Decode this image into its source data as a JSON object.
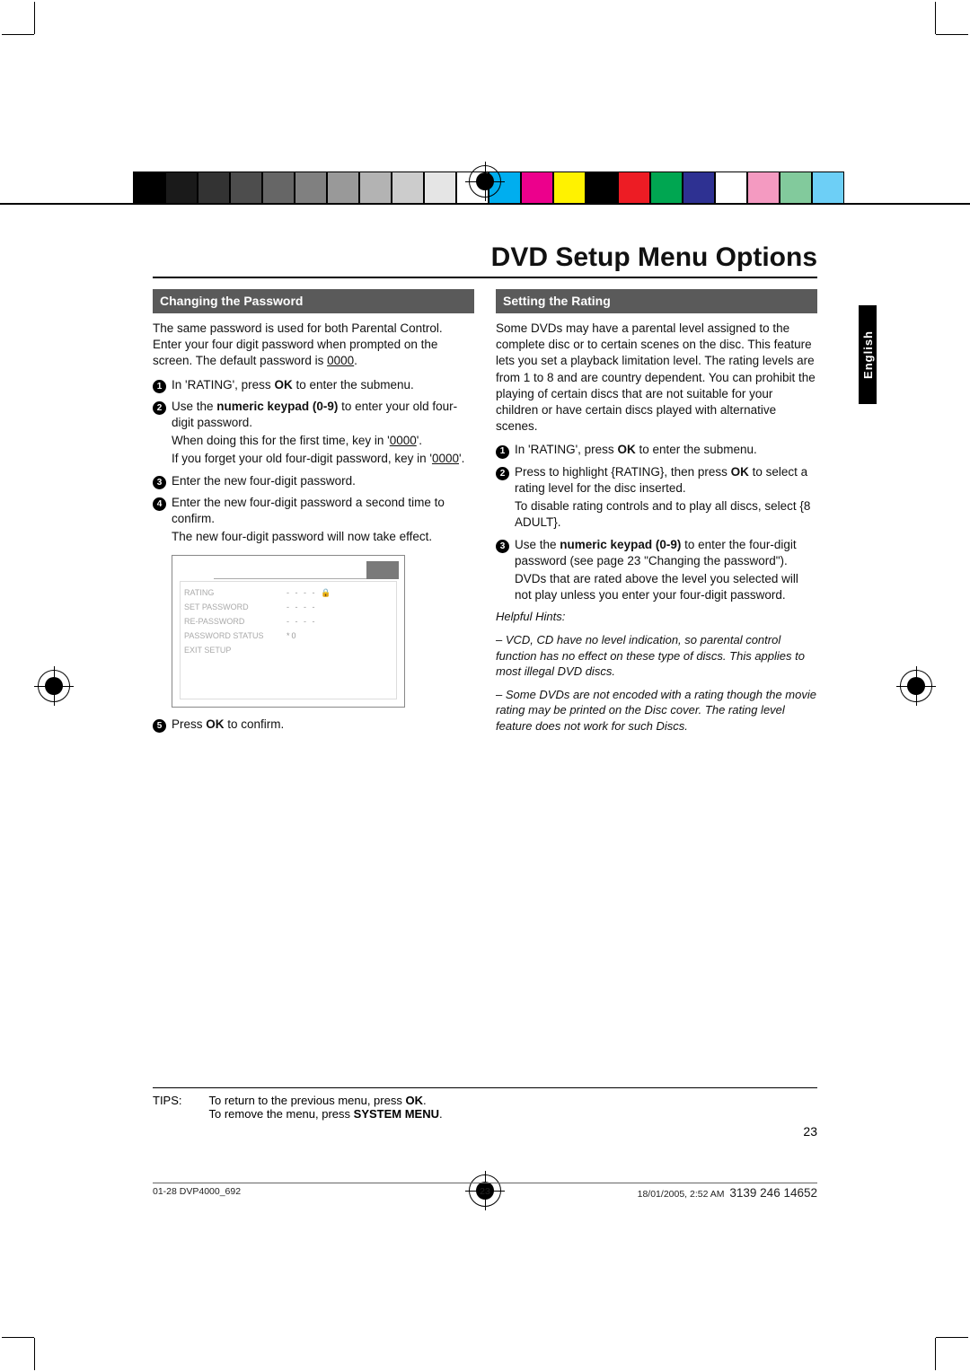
{
  "page_title": "DVD Setup Menu Options",
  "lang_tab": "English",
  "left": {
    "heading": "Changing the Password",
    "intro_a": "The same password is used for both Parental Control. Enter your four digit password when prompted on the screen. The default password is ",
    "intro_default": "0000",
    "intro_b": ".",
    "steps": {
      "s1_a": "In 'RATING', press ",
      "s1_b": " to enter the submenu.",
      "s2_a": "Use the ",
      "s2_kbd": "numeric keypad (0-9)",
      "s2_b": " to enter your old four-digit password.",
      "s2_sub1_a": "When doing this for the first time, key in '",
      "s2_sub_pwd": "0000",
      "s2_sub1_b": "'.",
      "s2_sub2_a": "If you forget your old four-digit password, key in '",
      "s2_sub2_b": "'.",
      "s3": "Enter the new four-digit password.",
      "s4": "Enter the new four-digit password a second time to confirm.",
      "s4_sub": "The new four-digit password will now take effect.",
      "s5_a": "Press ",
      "s5_b": " to confirm."
    },
    "ok_label": "OK"
  },
  "osd": {
    "menu": [
      "RATING",
      "SET PASSWORD",
      "RE-PASSWORD",
      "PASSWORD STATUS",
      "EXIT SETUP"
    ],
    "fields": [
      "- - - -  🔒",
      "- - - -",
      "- - - -",
      "*0"
    ]
  },
  "right": {
    "heading": "Setting the Rating",
    "intro": "Some DVDs may have a parental level assigned to the complete disc or to certain scenes on the disc. This feature lets you set a playback limitation level. The rating levels are from 1 to 8 and are country dependent. You can prohibit the playing of certain discs that are not suitable for your children or have certain discs played with alternative scenes.",
    "steps": {
      "s1_a": "In 'RATING', press ",
      "s1_b": " to enter the submenu.",
      "s2_a": "Press ",
      "s2_mid": " to highlight {RATING}, then press ",
      "s2_b": " to select a rating level for the disc inserted.",
      "s2_sub": "To disable rating controls and to play all discs, select {8 ADULT}.",
      "s3_a": "Use the ",
      "s3_kbd": "numeric keypad (0-9)",
      "s3_b": " to enter the four-digit password (see page 23 \"Changing the password\").",
      "s3_sub": "DVDs that are rated above the level you selected will not play unless you enter your four-digit password."
    },
    "ok_label": "OK",
    "hints_title": "Helpful Hints:",
    "hint1": "–   VCD, CD have no level indication, so parental control function has no effect on these type of discs. This applies to most illegal DVD discs.",
    "hint2": "–   Some DVDs are not encoded with a rating though the movie rating may be printed on the Disc cover. The rating level feature does not work for such Discs."
  },
  "tips": {
    "label": "TIPS:",
    "line1_a": "To return to the previous menu, press ",
    "line1_b": ".",
    "line2_a": "To remove the menu, press ",
    "line2_bold": "SYSTEM MENU",
    "line2_b": ".",
    "ok_label": "OK"
  },
  "page_number": "23",
  "footer": {
    "left": "01-28 DVP4000_692",
    "center": "23",
    "right_time": "18/01/2005, 2:52 AM",
    "part": "3139 246 14652"
  },
  "colors": {
    "left_bars": [
      "#000000",
      "#1a1a1a",
      "#333333",
      "#4d4d4d",
      "#666666",
      "#808080",
      "#999999",
      "#b3b3b3",
      "#cccccc",
      "#e5e5e5",
      "#ffffff"
    ],
    "right_bars": [
      "#00aeef",
      "#ec008c",
      "#fff200",
      "#000000",
      "#ed1c24",
      "#00a651",
      "#2e3192",
      "#ffffff",
      "#f49ac1",
      "#82ca9c",
      "#6dcff6"
    ]
  }
}
